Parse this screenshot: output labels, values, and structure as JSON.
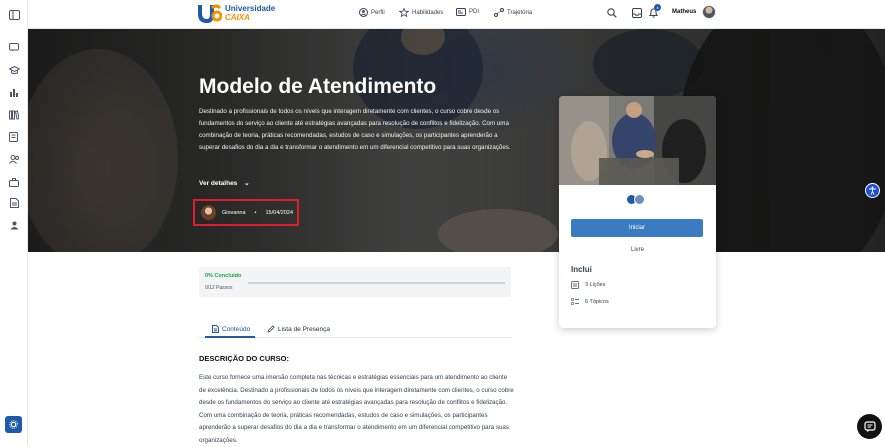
{
  "brand": {
    "line1": "Universidade",
    "line2": "CAIXA",
    "colors": {
      "primary": "#1e5aa8",
      "accent": "#f39200"
    }
  },
  "nav": {
    "items": [
      {
        "label": "Perfil",
        "icon": "user-circle-icon"
      },
      {
        "label": "Habilidades",
        "icon": "star-icon"
      },
      {
        "label": "PDI",
        "icon": "id-card-icon"
      },
      {
        "label": "Trajetória",
        "icon": "path-icon"
      }
    ],
    "notifications_count": "4",
    "user_name": "Matheus"
  },
  "sidebar": {
    "icons": [
      "sidebar-toggle-icon",
      "chat-bubble-icon",
      "graduation-cap-icon",
      "bar-chart-icon",
      "library-icon",
      "checklist-icon",
      "users-icon",
      "briefcase-icon",
      "document-icon",
      "team-icon"
    ],
    "bottom_icon": "settings-icon"
  },
  "hero": {
    "title": "Modelo de Atendimento",
    "description": "Destinado a profissionais de todos os níveis que interagem diretamente com clientes, o curso cobre desde os fundamentos do serviço ao cliente até estratégias avançadas para resolução de conflitos e fidelização. Com uma combinação de teoria, práticas recomendadas, estudos de caso e simulações, os participantes aprenderão a superar desafios do dia a dia e transformar o atendimento em um diferencial competitivo para suas organizações.",
    "more_label": "Ver detalhes",
    "author": "Giovanna",
    "separator": "•",
    "date": "15/04/2024"
  },
  "card": {
    "start_label": "Iniciar",
    "price_label": "Livre",
    "includes_title": "Inclui",
    "includes": [
      {
        "label": "3 Lições",
        "icon": "book-icon"
      },
      {
        "label": "6 Tópicos",
        "icon": "list-icon"
      }
    ]
  },
  "progress": {
    "label": "0% Concluído",
    "steps": "0/12 Passos",
    "fraction": 0
  },
  "tabs": [
    {
      "label": "Conteúdo",
      "icon": "document-icon",
      "active": true
    },
    {
      "label": "Lista de Presença",
      "icon": "pencil-icon",
      "active": false
    }
  ],
  "course": {
    "heading": "DESCRIÇÃO DO CURSO:",
    "text": "Este curso fornece uma imersão completa nas técnicas e estratégias essenciais para um atendimento ao cliente de excelência. Destinado a profissionais de todos os níveis que interagem diretamente com clientes, o curso cobre desde os fundamentos do serviço ao cliente até estratégias avançadas para resolução de conflitos e fidelização. Com uma combinação de teoria, práticas recomendadas, estudos de caso e simulações, os participantes aprenderão a superar desafios do dia a dia e transformar o atendimento em um diferencial competitivo para suas organizações."
  }
}
